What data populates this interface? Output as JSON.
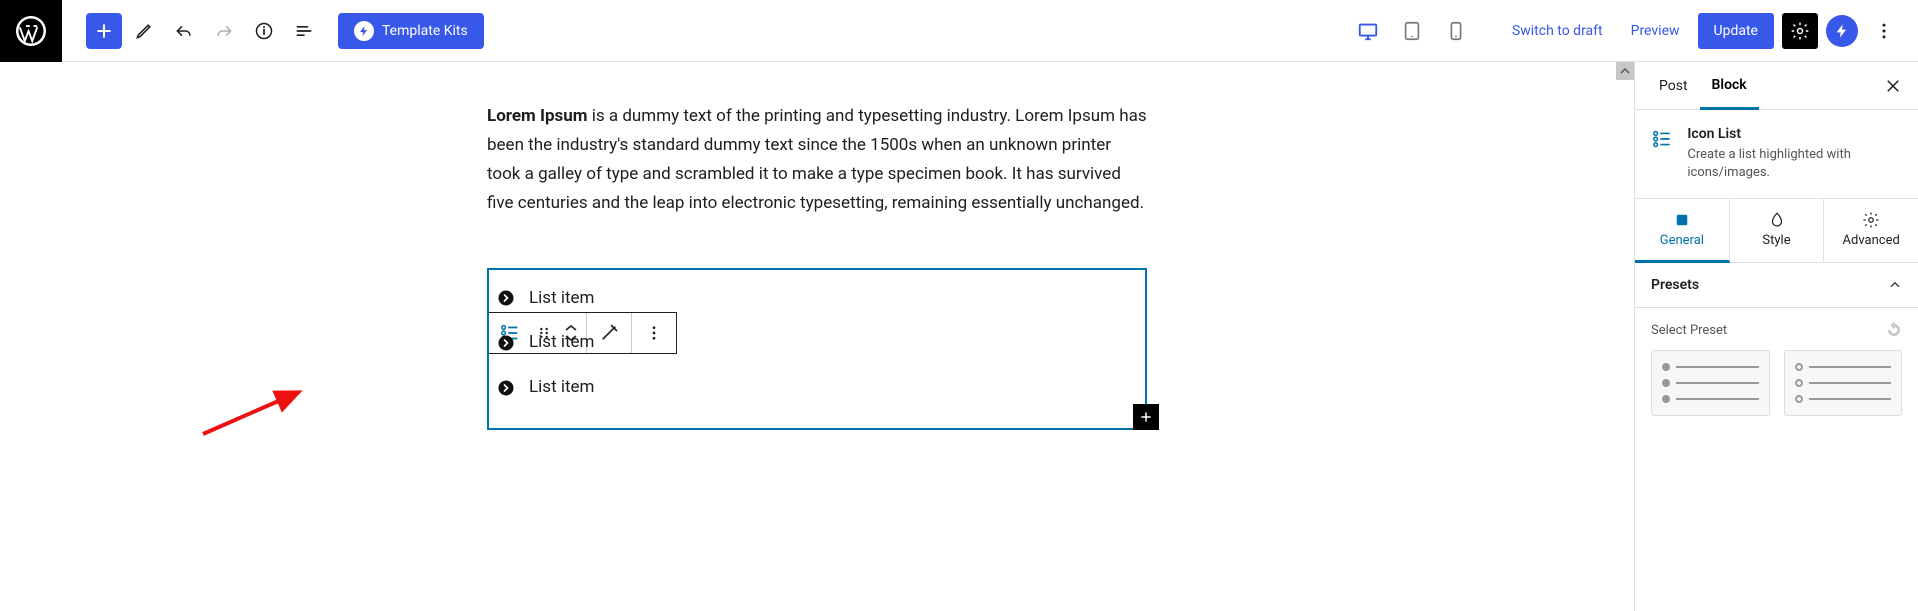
{
  "topbar": {
    "template_kits_label": "Template Kits",
    "switch_draft": "Switch to draft",
    "preview": "Preview",
    "update": "Update"
  },
  "content": {
    "bold": "Lorem Ipsum",
    "para": " is a dummy text of the printing and typesetting industry. Lorem Ipsum has been the industry's standard dummy text since the 1500s when an unknown printer took a galley of type and scrambled it to make a type specimen book. It has survived five centuries and the leap into electronic typesetting, remaining essentially unchanged."
  },
  "icon_list": {
    "items": [
      "List item",
      "List item",
      "List item"
    ]
  },
  "sidebar": {
    "tab_post": "Post",
    "tab_block": "Block",
    "block_name": "Icon List",
    "block_desc": "Create a list highlighted with icons/images.",
    "subtabs": {
      "general": "General",
      "style": "Style",
      "advanced": "Advanced"
    },
    "presets_header": "Presets",
    "select_preset": "Select Preset"
  }
}
